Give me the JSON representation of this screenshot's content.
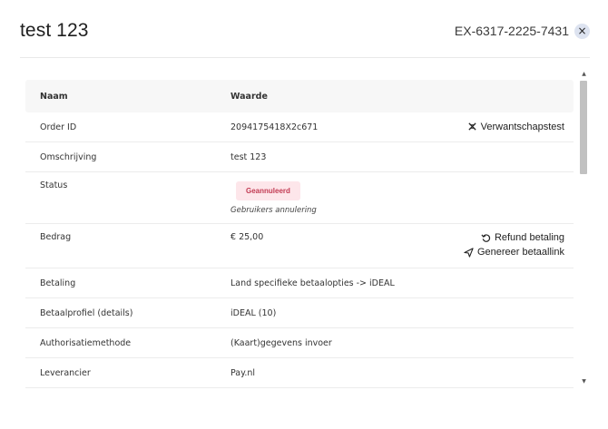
{
  "modal": {
    "title": "test 123",
    "reference": "EX-6317-2225-7431",
    "close_label": "×"
  },
  "table": {
    "headers": {
      "name": "Naam",
      "value": "Waarde"
    },
    "rows": {
      "order_id": {
        "label": "Order ID",
        "value": "2094175418X2c671",
        "action": "Verwantschapstest"
      },
      "omschrijving": {
        "label": "Omschrijving",
        "value": "test 123"
      },
      "status": {
        "label": "Status",
        "badge": "Geannuleerd",
        "sub": "Gebruikers annulering"
      },
      "bedrag": {
        "label": "Bedrag",
        "value": "€ 25,00",
        "action_refund": "Refund betaling",
        "action_link": "Genereer betaallink"
      },
      "betaling": {
        "label": "Betaling",
        "value": "Land specifieke betaalopties -> iDEAL"
      },
      "betaalprofiel": {
        "label": "Betaalprofiel (details)",
        "value": "iDEAL (10)"
      },
      "authorisatie": {
        "label": "Authorisatiemethode",
        "value": "(Kaart)gegevens invoer"
      },
      "leverancier": {
        "label": "Leverancier",
        "value": "Pay.nl"
      }
    }
  },
  "colors": {
    "badge_bg": "#fde6ea",
    "badge_text": "#c23b53",
    "close_bg": "#dde3f0"
  },
  "icons": {
    "dna": "dna-icon",
    "refund": "refresh-icon",
    "link": "send-icon",
    "close": "close-icon"
  }
}
